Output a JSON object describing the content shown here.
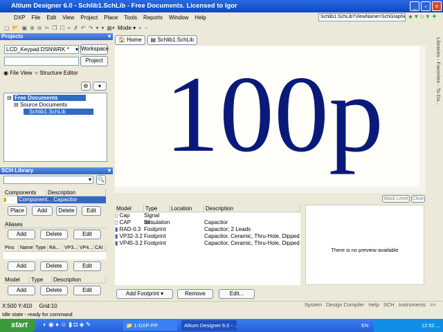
{
  "window": {
    "title": "Altium Designer 6.0 - Schlib1.SchLib - Free Documents. Licensed to Igor"
  },
  "menu": [
    "DXP",
    "File",
    "Edit",
    "View",
    "Project",
    "Place",
    "Tools",
    "Reports",
    "Window",
    "Help"
  ],
  "address": "Schlib1.SchLib?ViewName=SchGraphic",
  "toolbar": {
    "mode_label": "Mode"
  },
  "projects": {
    "title": "Projects",
    "workspace_value": "LCD_Keypad.DSNWRK *",
    "workspace_btn": "Workspace",
    "project_btn": "Project",
    "radio_file_view": "File View",
    "radio_structure": "Structure Editor",
    "tree": [
      "Free Documents",
      "Source Documents",
      "Schlib1.SchLib"
    ]
  },
  "tabs": [
    {
      "label": "Home"
    },
    {
      "label": "Schlib1.SchLib"
    }
  ],
  "canvas": {
    "text": "100p",
    "text_color": "#0a1a7a"
  },
  "side_tabs": "Libraries - Favorites - To Do...",
  "sch_library": {
    "title": "SCH Library",
    "columns": [
      "Components",
      "Description"
    ],
    "rows": [
      {
        "component": "Component...",
        "description": "Capacitor"
      }
    ],
    "buttons": [
      "Place",
      "Add",
      "Delete",
      "Edit"
    ],
    "aliases": {
      "title": "Aliases",
      "buttons": [
        "Add",
        "Delete",
        "Edit"
      ]
    },
    "pins": {
      "columns": [
        "Pins",
        "Name",
        "Type",
        "RA...",
        "VP3...",
        "VP4...",
        "CAI"
      ],
      "buttons": [
        "Add",
        "Delete",
        "Edit"
      ]
    },
    "model": {
      "columns": [
        "Model",
        "Type",
        "Description"
      ],
      "buttons": [
        "Add",
        "Delete",
        "Edit"
      ]
    }
  },
  "mask": {
    "mask_level": "Mask Level",
    "clear": "Clear"
  },
  "models": {
    "columns": [
      "Model",
      "Type",
      "Location",
      "Description"
    ],
    "rows": [
      {
        "model": "Cap",
        "type": "Signal Int...",
        "location": "",
        "description": ""
      },
      {
        "model": "CAP",
        "type": "Simulation",
        "location": "",
        "description": "Capacitor"
      },
      {
        "model": "RAD-0.3",
        "type": "Footprint",
        "location": "",
        "description": "Capacitor; 2 Leads"
      },
      {
        "model": "VP32-3.2",
        "type": "Footprint",
        "location": "",
        "description": "Capacitor, Ceramic, Thru-Hole, Dipped Radi..."
      },
      {
        "model": "VP45-3.2",
        "type": "Footprint",
        "location": "",
        "description": "Capacitor, Ceramic, Thru-Hole, Dipped Radi..."
      }
    ],
    "add_footprint": "Add Footprint",
    "remove": "Remove",
    "edit": "Edit...",
    "preview": "There is no preview available"
  },
  "status": {
    "coords": "X:500 Y:410",
    "grid": "Grid:10",
    "message": "Idle state - ready for command",
    "panels": [
      "System",
      "Design Compiler",
      "Help",
      "SCH",
      "Instruments",
      ">>"
    ]
  },
  "taskbar": {
    "start": "start",
    "tasks": [
      "1-DXP-PP",
      "Altium Designer 6.0 - ..."
    ],
    "lang": "EN",
    "clock": "12:52 ..."
  }
}
